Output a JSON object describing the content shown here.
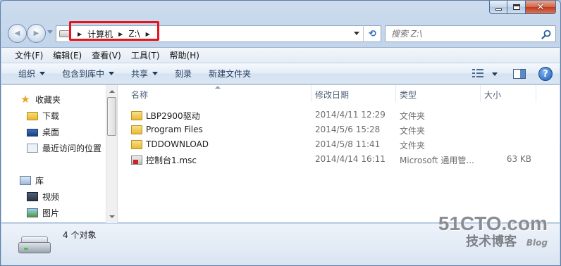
{
  "window": {
    "caption_buttons": {
      "minimize": "—",
      "maximize": "□",
      "close": "✕"
    }
  },
  "navigation": {
    "back_glyph": "◀",
    "forward_glyph": "▶",
    "address": {
      "breadcrumbs": [
        "计算机",
        "Z:\\"
      ],
      "separator": "▶"
    },
    "refresh_glyph": "⟲",
    "search": {
      "placeholder": "搜索 Z:\\"
    }
  },
  "menu": {
    "items": [
      "文件(F)",
      "编辑(E)",
      "查看(V)",
      "工具(T)",
      "帮助(H)"
    ]
  },
  "commands": {
    "organize": "组织",
    "include_in_library": "包含到库中",
    "share": "共享",
    "burn": "刻录",
    "new_folder": "新建文件夹",
    "help_glyph": "?"
  },
  "sidebar": {
    "favorites": {
      "label": "收藏夹",
      "items": [
        "下载",
        "桌面",
        "最近访问的位置"
      ]
    },
    "libraries": {
      "label": "库",
      "items": [
        "视频",
        "图片"
      ]
    }
  },
  "file_list": {
    "columns": {
      "name": "名称",
      "date": "修改日期",
      "type": "类型",
      "size": "大小"
    },
    "rows": [
      {
        "name": "LBP2900驱动",
        "date": "2014/4/11 12:29",
        "type": "文件夹",
        "size": "",
        "icon": "folder-icon"
      },
      {
        "name": "Program Files",
        "date": "2014/5/6 15:28",
        "type": "文件夹",
        "size": "",
        "icon": "folder-icon"
      },
      {
        "name": "TDDOWNLOAD",
        "date": "2014/5/8 11:41",
        "type": "文件夹",
        "size": "",
        "icon": "folder-icon"
      },
      {
        "name": "控制台1.msc",
        "date": "2014/4/14 16:11",
        "type": "Microsoft 通用管...",
        "size": "63 KB",
        "icon": "msc-file-icon"
      }
    ]
  },
  "status": {
    "item_count": "4 个对象"
  },
  "watermark": {
    "main": "51CTO.com",
    "sub": "技术博客",
    "blog": "Blog"
  },
  "colors": {
    "address_highlight": "#e8141b",
    "window_frame": "#bcd0e7"
  }
}
